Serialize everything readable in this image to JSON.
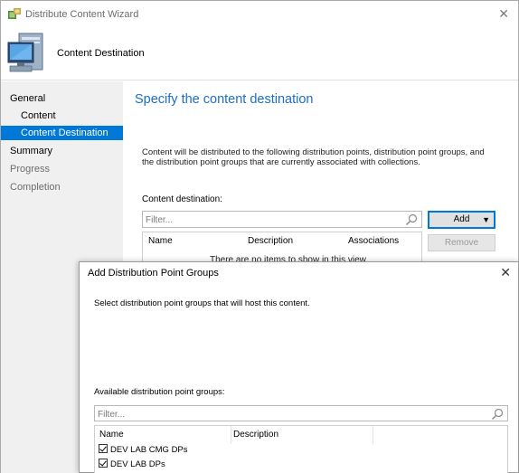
{
  "window": {
    "title": "Distribute Content Wizard",
    "close_glyph": "✕"
  },
  "header": {
    "title": "Content Destination"
  },
  "nav": {
    "general": "General",
    "content": "Content",
    "content_destination": "Content Destination",
    "summary": "Summary",
    "progress": "Progress",
    "completion": "Completion"
  },
  "main": {
    "heading": "Specify the content destination",
    "description": "Content will be distributed to the following distribution points, distribution point groups, and the distribution point groups that are currently associated with collections.",
    "destination_label": "Content destination:",
    "filter_placeholder": "Filter...",
    "add_label": "Add",
    "remove_label": "Remove",
    "columns": [
      "Name",
      "Description",
      "Associations"
    ],
    "empty_message": "There are no items to show in this view."
  },
  "dialog": {
    "title": "Add Distribution Point Groups",
    "close_glyph": "✕",
    "description": "Select distribution point groups that will host this content.",
    "available_label": "Available distribution point groups:",
    "filter_placeholder": "Filter...",
    "columns": [
      "Name",
      "Description"
    ],
    "items": [
      {
        "name": "DEV LAB CMG DPs",
        "checked": true
      },
      {
        "name": "DEV LAB DPs",
        "checked": true
      }
    ]
  },
  "colors": {
    "accent": "#0078d7",
    "heading": "#1e6fc4",
    "nav_bg": "#f0f0f0"
  }
}
